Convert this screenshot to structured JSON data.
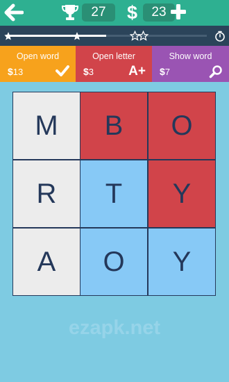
{
  "topbar": {
    "score": "27",
    "currency_symbol": "$",
    "coins": "23",
    "colors": {
      "bar": "#2eb091",
      "pill": "#2a8f75"
    },
    "icons": [
      "back-arrow-icon",
      "trophy-icon",
      "plus-icon"
    ]
  },
  "progress": {
    "level": 0.5,
    "stars": [
      {
        "state": "filled"
      },
      {
        "state": "filled"
      },
      {
        "state": "outline"
      },
      {
        "state": "outline"
      }
    ],
    "icons": [
      "star-icon",
      "timer-icon"
    ]
  },
  "hints": [
    {
      "label": "Open word",
      "currency": "$",
      "price": "13",
      "icon": "checkmark-icon",
      "color": "#f7a21c"
    },
    {
      "label": "Open letter",
      "currency": "$",
      "price": "3",
      "icon_text": "A+",
      "color": "#d1444a"
    },
    {
      "label": "Show word",
      "currency": "$",
      "price": "7",
      "icon": "magnifier-icon",
      "color": "#9a54b3"
    }
  ],
  "grid": {
    "rows": [
      [
        {
          "letter": "M",
          "state": "neutral"
        },
        {
          "letter": "B",
          "state": "red"
        },
        {
          "letter": "O",
          "state": "red"
        }
      ],
      [
        {
          "letter": "R",
          "state": "neutral"
        },
        {
          "letter": "T",
          "state": "blue"
        },
        {
          "letter": "Y",
          "state": "red"
        }
      ],
      [
        {
          "letter": "A",
          "state": "neutral"
        },
        {
          "letter": "O",
          "state": "blue"
        },
        {
          "letter": "Y",
          "state": "blue"
        }
      ]
    ],
    "colors": {
      "neutral": "#ececec",
      "red": "#d1444a",
      "blue": "#87c9f6",
      "text": "#24385a"
    }
  },
  "watermark": "ezapk.net"
}
